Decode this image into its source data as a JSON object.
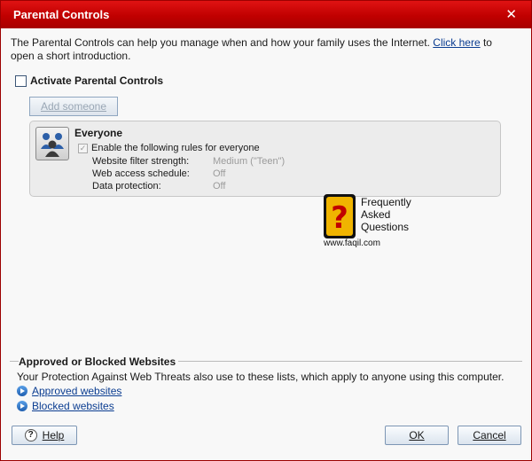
{
  "window": {
    "title": "Parental Controls",
    "close_glyph": "✕"
  },
  "intro": {
    "text": "The Parental Controls can help you manage when and how your family uses the Internet. ",
    "link": "Click here",
    "suffix": " to open a short introduction."
  },
  "activate": {
    "label": "Activate Parental Controls",
    "checked": false
  },
  "add_someone": {
    "label": "Add someone",
    "enabled": false
  },
  "everyone": {
    "title": "Everyone",
    "rule_label": "Enable the following rules for everyone",
    "rule_checked": true,
    "rows": [
      {
        "label": "Website filter strength:",
        "value": "Medium (\"Teen\")"
      },
      {
        "label": "Web access schedule:",
        "value": "Off"
      },
      {
        "label": "Data protection:",
        "value": "Off"
      }
    ]
  },
  "faq": {
    "glyph": "?",
    "line1": "Frequently",
    "line2": "Asked",
    "line3": "Questions",
    "url": "www.faqil.com"
  },
  "websites": {
    "title": "Approved or Blocked Websites",
    "description": "Your Protection Against Web Threats also use to these lists, which apply to anyone using this computer.",
    "approved_link": "Approved websites",
    "blocked_link": "Blocked websites"
  },
  "buttons": {
    "help": "Help",
    "ok": "OK",
    "cancel": "Cancel"
  },
  "colors": {
    "titlebar": "#c00000",
    "link": "#0b3d91",
    "disabled_text": "#9aa7b5"
  }
}
